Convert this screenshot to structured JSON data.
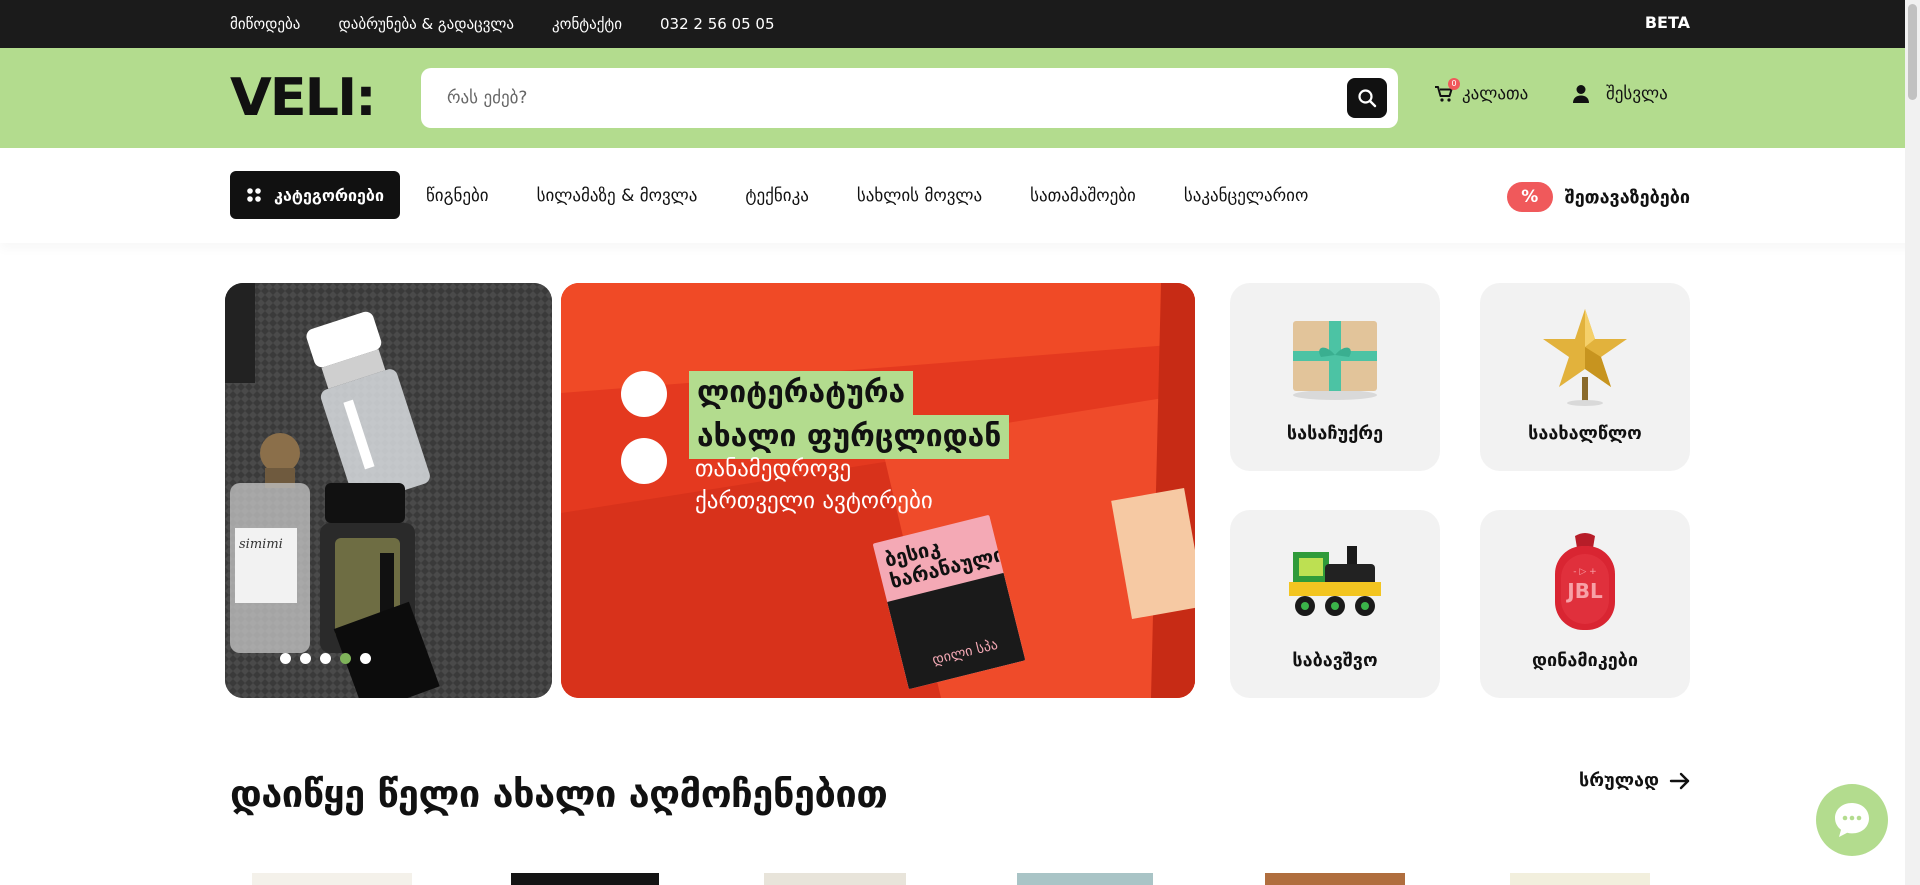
{
  "topbar": {
    "links": [
      "მიწოდება",
      "დაბრუნება & გადაცვლა",
      "კონტაქტი",
      "032 2 56 05 05"
    ],
    "beta": "BETA"
  },
  "header": {
    "logo": "VELI:",
    "search_placeholder": "რას ეძებ?",
    "cart_label": "კალათა",
    "cart_count": "0",
    "login_label": "შესვლა"
  },
  "nav": {
    "categories_label": "კატეგორიები",
    "items": [
      "წიგნები",
      "სილამაზე & მოვლა",
      "ტექნიკა",
      "სახლის მოვლა",
      "სათამაშოები",
      "საკანცელარიო"
    ],
    "deals_badge": "%",
    "deals_label": "შეთავაზებები"
  },
  "hero": {
    "title_line1": "ლიტერატურა",
    "title_line2": "ახალი ფურცლიდან",
    "sub_line1": "თანამედროვე",
    "sub_line2": "ქართველი ავტორები",
    "book_title": "ბესიკ ხარანაული",
    "book_bottom": "დილი სპა",
    "slide_count": 5,
    "active_slide": 4
  },
  "tiles": [
    {
      "label": "სასაჩუქრე",
      "icon": "gift-icon"
    },
    {
      "label": "საახალწლო",
      "icon": "star-icon"
    },
    {
      "label": "საბავშვო",
      "icon": "toy-train-icon"
    },
    {
      "label": "დინამიკები",
      "icon": "speaker-icon"
    }
  ],
  "section": {
    "title": "დაიწყე წელი ახალი აღმოჩენებით",
    "see_all": "სრულად"
  },
  "colors": {
    "accent_green": "#b3dc8e",
    "topbar": "#1b1b1b",
    "badge_red": "#f0595b",
    "hero_red": "#e23b23"
  }
}
